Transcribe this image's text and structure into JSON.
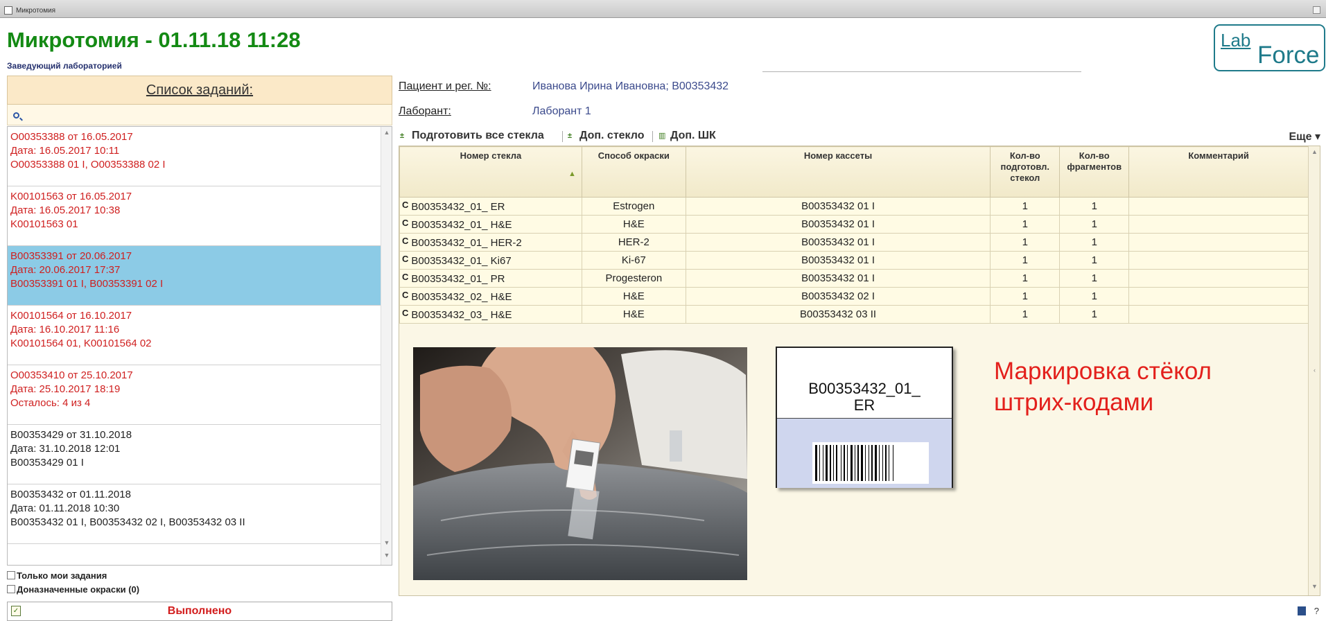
{
  "window": {
    "title": "Микротомия"
  },
  "header": {
    "title": "Микротомия - 01.11.18 11:28",
    "subtitle": "Заведующий лабораторией",
    "logo": {
      "part1": "Lab",
      "part2": "Force"
    }
  },
  "task_list": {
    "title": "Список заданий:",
    "items": [
      {
        "line1": "O00353388 от 16.05.2017",
        "line2": "Дата: 16.05.2017  10:11",
        "line3": "O00353388  01 I, O00353388  02 I",
        "color": "#cf1f1f",
        "selected": false
      },
      {
        "line1": "K00101563 от 16.05.2017",
        "line2": "Дата: 16.05.2017  10:38",
        "line3": "K00101563  01",
        "color": "#cf1f1f",
        "selected": false
      },
      {
        "line1": "B00353391 от 20.06.2017",
        "line2": "Дата: 20.06.2017  17:37",
        "line3": "B00353391 01 I, B00353391 02 I",
        "color": "#cf1f1f",
        "selected": true
      },
      {
        "line1": "K00101564 от 16.10.2017",
        "line2": "Дата: 16.10.2017  11:16",
        "line3": "K00101564  01, K00101564  02",
        "color": "#cf1f1f",
        "selected": false
      },
      {
        "line1": "O00353410 от 25.10.2017",
        "line2": "Дата: 25.10.2017  18:19",
        "line3": "Осталось: 4 из 4",
        "color": "#cf1f1f",
        "selected": false
      },
      {
        "line1": "B00353429 от 31.10.2018",
        "line2": "Дата: 31.10.2018  12:01",
        "line3": "B00353429 01 I",
        "color": "#222222",
        "selected": false
      },
      {
        "line1": "B00353432 от 01.11.2018",
        "line2": "Дата: 01.11.2018  10:30",
        "line3": "B00353432 01 I, B00353432 02 I, B00353432 03 II",
        "color": "#222222",
        "selected": false
      }
    ]
  },
  "filters": {
    "only_mine": "Только мои задания",
    "extra_stains": "Доназначенные окраски (0)"
  },
  "status": {
    "done_label": "Выполнено"
  },
  "patient": {
    "label": "Пациент и рег. №:",
    "value": "Иванова Ирина Ивановна; B00353432"
  },
  "lab": {
    "label": "Лаборант:",
    "value": "Лаборант 1"
  },
  "toolbar": {
    "prepare_all": "Подготовить все стекла",
    "add_slide": "Доп. стекло",
    "add_barcode": "Доп. ШК",
    "more": "Еще"
  },
  "grid": {
    "columns": [
      "Номер стекла",
      "Способ окраски",
      "Номер кассеты",
      "Кол-во подготовл. стекол",
      "Кол-во фрагментов",
      "Комментарий"
    ],
    "row_mark": "C",
    "rows": [
      {
        "slide": "B00353432_01_ ER",
        "stain": "Estrogen",
        "cassette": "B00353432 01 I",
        "prepared": "1",
        "fragments": "1",
        "comment": ""
      },
      {
        "slide": "B00353432_01_ H&E",
        "stain": "H&E",
        "cassette": "B00353432 01 I",
        "prepared": "1",
        "fragments": "1",
        "comment": ""
      },
      {
        "slide": "B00353432_01_ HER-2",
        "stain": "HER-2",
        "cassette": "B00353432 01 I",
        "prepared": "1",
        "fragments": "1",
        "comment": ""
      },
      {
        "slide": "B00353432_01_ Ki67",
        "stain": "Ki-67",
        "cassette": "B00353432 01 I",
        "prepared": "1",
        "fragments": "1",
        "comment": ""
      },
      {
        "slide": "B00353432_01_ PR",
        "stain": "Progesteron",
        "cassette": "B00353432 01 I",
        "prepared": "1",
        "fragments": "1",
        "comment": ""
      },
      {
        "slide": "B00353432_02_ H&E",
        "stain": "H&E",
        "cassette": "B00353432 02 I",
        "prepared": "1",
        "fragments": "1",
        "comment": ""
      },
      {
        "slide": "B00353432_03_ H&E",
        "stain": "H&E",
        "cassette": "B00353432 03 II",
        "prepared": "1",
        "fragments": "1",
        "comment": ""
      }
    ]
  },
  "label_preview": {
    "line1": "B00353432_01_",
    "line2": "ER"
  },
  "caption": {
    "line1": "Маркировка стёкол",
    "line2": "штрих-кодами"
  },
  "footer": {
    "help": "?"
  },
  "colors": {
    "title_green": "#148a14",
    "selected_row": "#8ccbe6",
    "alert_red": "#e3201c",
    "header_band": "#fbe9c8"
  }
}
